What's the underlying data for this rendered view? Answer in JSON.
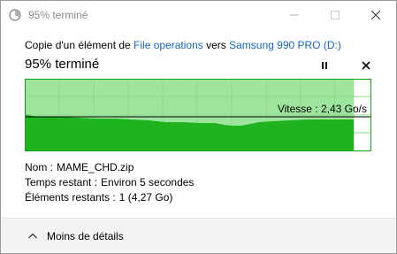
{
  "window": {
    "title": "95% terminé"
  },
  "header": {
    "copy_prefix": "Copie d'un élément de ",
    "source": "File operations",
    "copy_middle": " vers ",
    "destination": "Samsung 990 PRO (D:)",
    "progress_title": "95% terminé"
  },
  "progress": {
    "percent": 95,
    "speed_label": "Vitesse : 2,43 Go/s"
  },
  "details": {
    "name_label": "Nom :",
    "name_value": "MAME_CHD.zip",
    "time_label": "Temps restant :",
    "time_value": "Environ 5 secondes",
    "items_label": "Éléments restants :",
    "items_value": "1 (4,27 Go)"
  },
  "footer": {
    "less_details_label": "Moins de détails"
  },
  "colors": {
    "graph_fill_light": "#9ee59e",
    "graph_fill_dark": "#1fb41f",
    "graph_border": "#12a012",
    "link": "#1565c0"
  },
  "icons": {
    "app": "copy-window-icon",
    "pause": "pause-icon",
    "cancel": "close-icon",
    "chevron": "chevron-up-icon"
  }
}
